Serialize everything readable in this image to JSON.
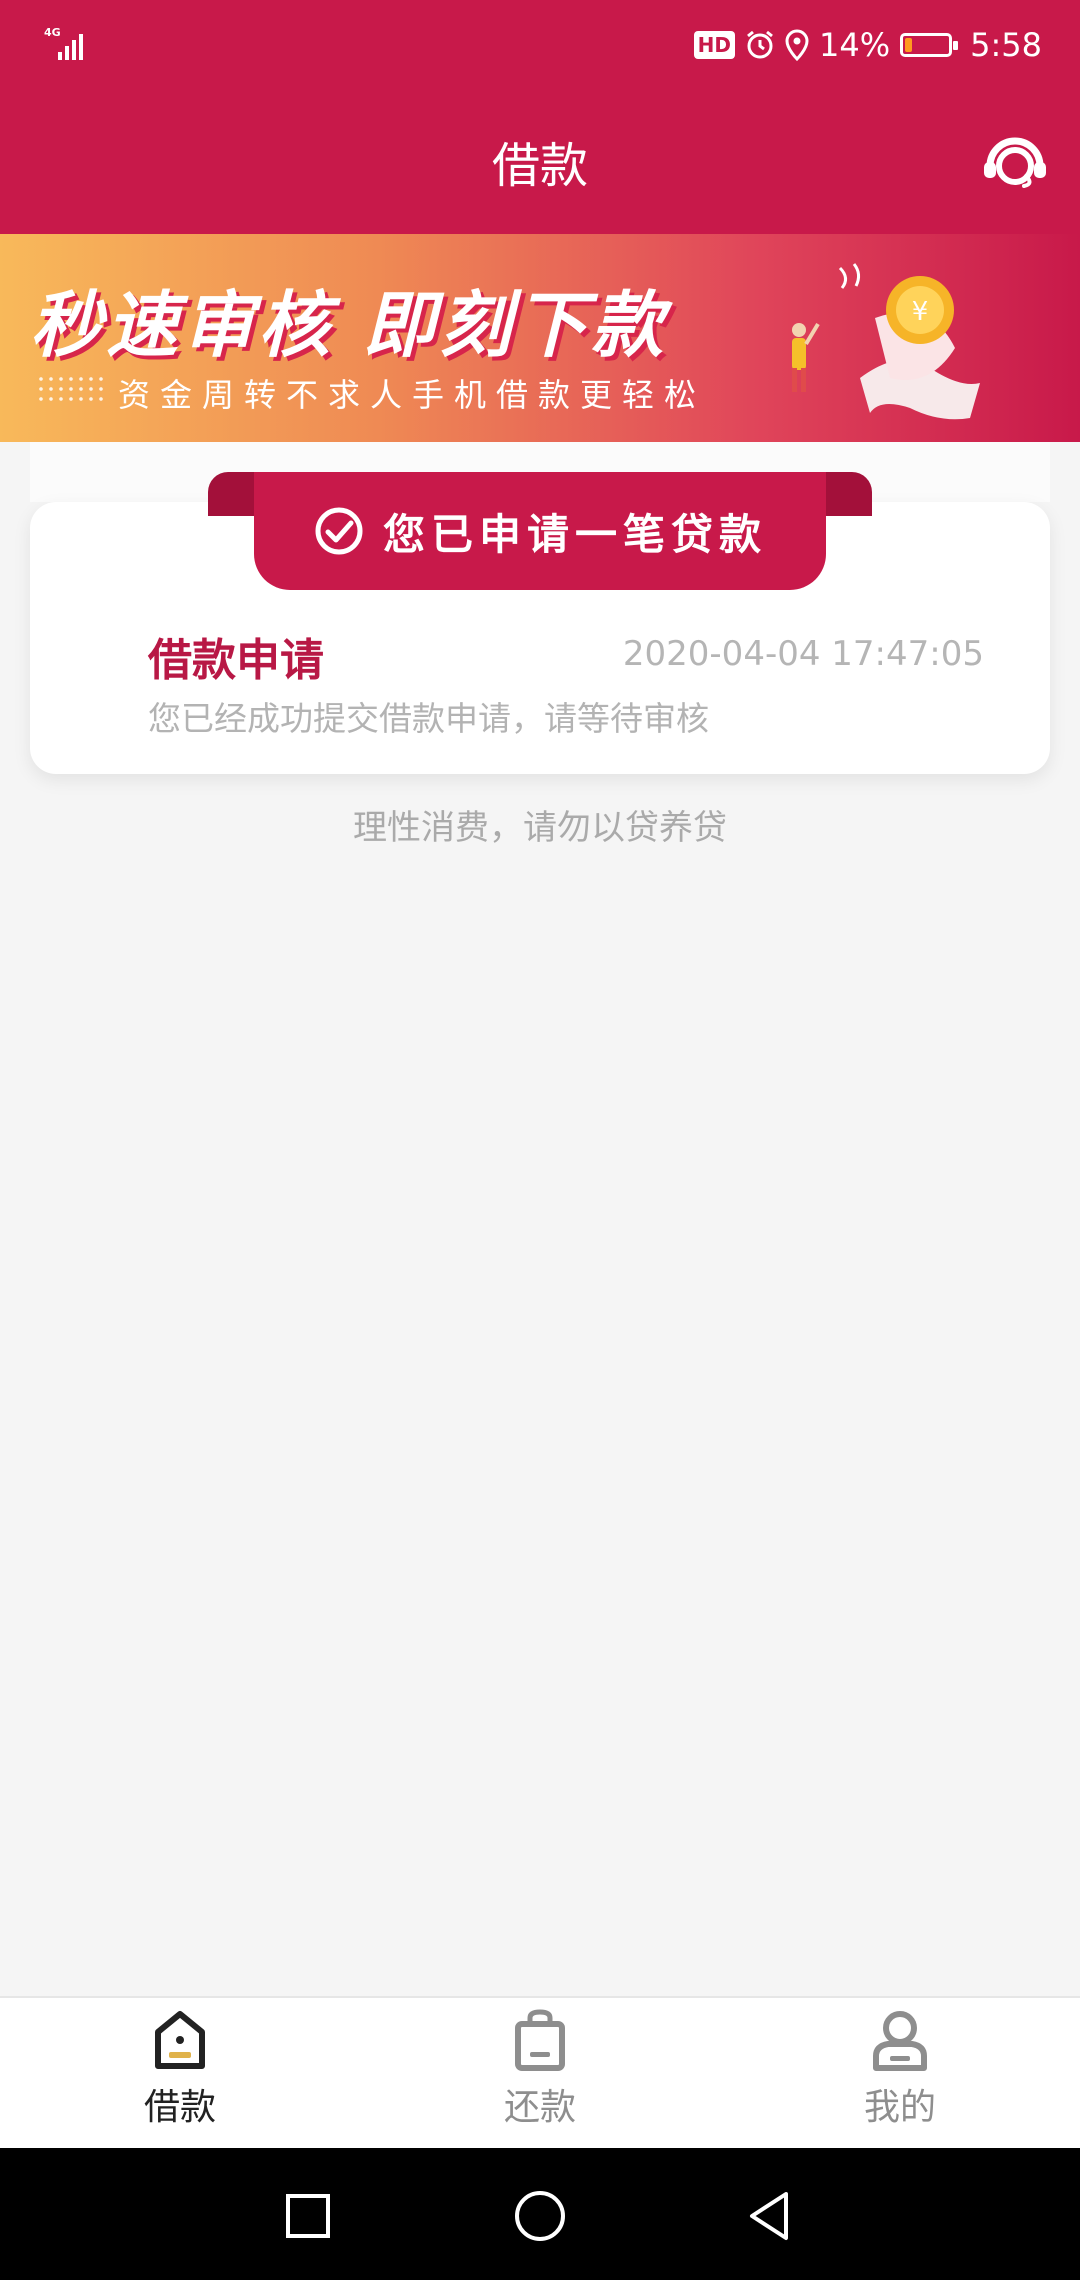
{
  "status_bar": {
    "network": "4G",
    "hd_badge": "HD",
    "battery": "14%",
    "battery_level": 0.14,
    "time": "5:58",
    "icons": [
      "signal-icon",
      "alarm-icon",
      "location-icon",
      "battery-icon"
    ]
  },
  "app_bar": {
    "title": "借款",
    "support_icon": "customer-service-headset-icon"
  },
  "banner": {
    "headline": "秒速审核  即刻下款",
    "subtitle": "资金周转不求人手机借款更轻松"
  },
  "application_card": {
    "ribbon_label": "您已申请一笔贷款",
    "title": "借款申请",
    "timestamp": "2020-04-04 17:47:05",
    "description": "您已经成功提交借款申请，请等待审核"
  },
  "notice": "理性消费，请勿以贷养贷",
  "tab_bar": {
    "items": [
      {
        "label": "借款",
        "icon": "borrow-home-icon",
        "active": true
      },
      {
        "label": "还款",
        "icon": "repay-bag-icon",
        "active": false
      },
      {
        "label": "我的",
        "icon": "profile-icon",
        "active": false
      }
    ]
  },
  "colors": {
    "brand": "#c8194a",
    "background": "#f5f5f5",
    "muted_text": "#b3b3b3"
  }
}
